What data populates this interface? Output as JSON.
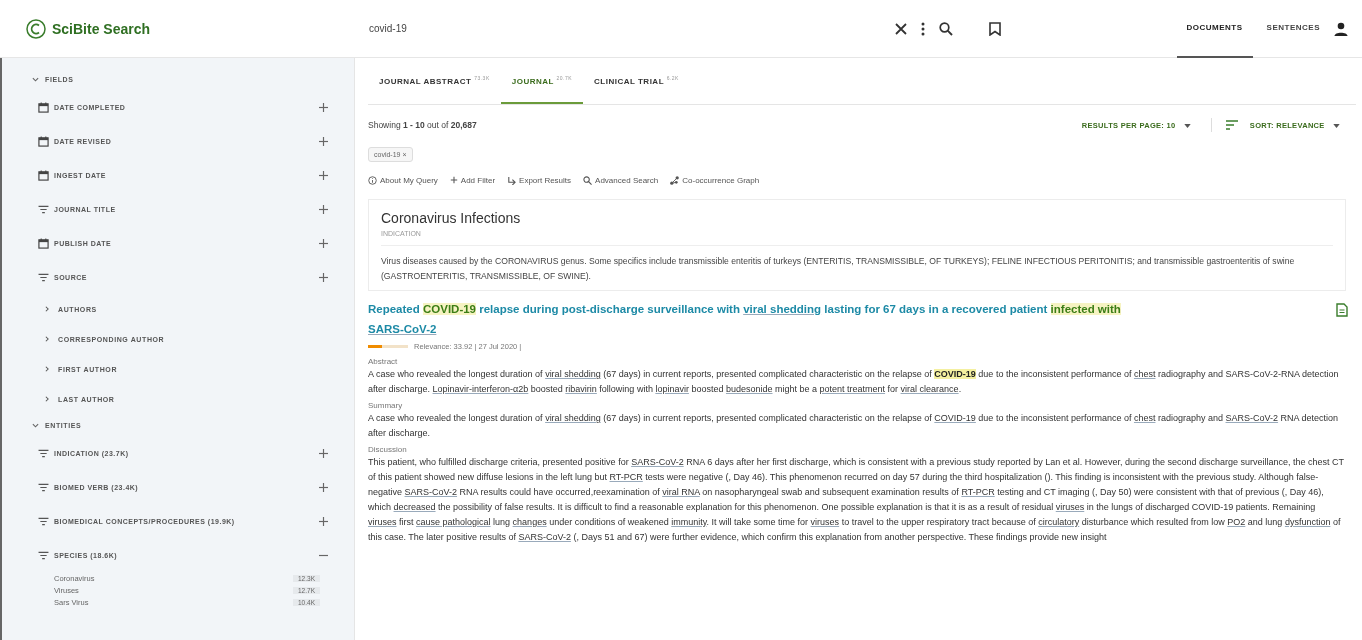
{
  "topbar": {
    "logo": "SciBite Search",
    "search_value": "covid-19",
    "nav": [
      {
        "label": "DOCUMENTS",
        "selected": true
      },
      {
        "label": "SENTENCES",
        "selected": false
      }
    ]
  },
  "sidebar": {
    "sections": [
      {
        "title": "FIELDS",
        "expanded": true,
        "items": [
          {
            "kind": "date",
            "label": "DATE COMPLETED",
            "expanded": false
          },
          {
            "kind": "date",
            "label": "DATE REVISED",
            "expanded": false
          },
          {
            "kind": "date",
            "label": "INGEST DATE",
            "expanded": false
          },
          {
            "kind": "filter",
            "label": "JOURNAL TITLE",
            "expanded": false
          },
          {
            "kind": "date",
            "label": "PUBLISH DATE",
            "expanded": false
          },
          {
            "kind": "filter",
            "label": "SOURCE",
            "expanded": false
          },
          {
            "kind": "sub",
            "label": "AUTHORS"
          },
          {
            "kind": "sub",
            "label": "CORRESPONDING AUTHOR"
          },
          {
            "kind": "sub",
            "label": "FIRST AUTHOR"
          },
          {
            "kind": "sub",
            "label": "LAST AUTHOR"
          }
        ]
      },
      {
        "title": "ENTITIES",
        "expanded": true,
        "items": [
          {
            "kind": "filter",
            "label": "INDICATION (23.7K)",
            "expanded": false
          },
          {
            "kind": "filter",
            "label": "BIOMED VERB (23.4K)",
            "expanded": false
          },
          {
            "kind": "filter",
            "label": "BIOMEDICAL CONCEPTS/PROCEDURES (19.9K)",
            "expanded": false
          },
          {
            "kind": "filter",
            "label": "SPECIES (18.6K)",
            "expanded": true,
            "values": [
              {
                "name": "Coronavirus",
                "count": "12.3K"
              },
              {
                "name": "Viruses",
                "count": "12.7K"
              },
              {
                "name": "Sars Virus",
                "count": "10.4K"
              }
            ]
          }
        ]
      }
    ]
  },
  "main": {
    "tabs": [
      {
        "label": "JOURNAL ABSTRACT",
        "count": "73.3K",
        "selected": false
      },
      {
        "label": "JOURNAL",
        "count": "20.7K",
        "selected": true
      },
      {
        "label": "CLINICAL TRIAL",
        "count": "6.2K",
        "selected": false
      }
    ],
    "showing": "Showing **1 - 10** out of **20,687**",
    "results_per_page": "RESULTS PER PAGE: 10",
    "sort": "SORT: RELEVANCE",
    "chips": [
      "covid-19 ×"
    ],
    "actions": [
      {
        "kind": "info",
        "label": "About My Query"
      },
      {
        "kind": "add",
        "label": "Add Filter"
      },
      {
        "kind": "export",
        "label": "Export Results"
      },
      {
        "kind": "search",
        "label": "Advanced Search"
      },
      {
        "kind": "graph",
        "label": "Co-occurrence Graph"
      }
    ],
    "concept": {
      "title": "Coronavirus Infections",
      "type": "INDICATION",
      "description": "Virus diseases caused by the CORONAVIRUS genus. Some specifics include transmissible enteritis of turkeys (ENTERITIS, TRANSMISSIBLE, OF TURKEYS); FELINE INFECTIOUS PERITONITIS; and transmissible gastroenteritis of swine (GASTROENTERITIS, TRANSMISSIBLE, OF SWINE)."
    },
    "result": {
      "title": [
        {
          "kind": "text",
          "text": "Repeated "
        },
        {
          "kind": "highlight",
          "text": "COVID-19"
        },
        {
          "kind": "text",
          "text": " relapse during post-discharge surveillance with "
        },
        {
          "kind": "term",
          "text": "viral shedding"
        },
        {
          "kind": "text",
          "text": " lasting for 67 days in a recovered patient "
        },
        {
          "kind": "highlight",
          "text": "infected with "
        },
        {
          "kind": "term",
          "text": "SARS-CoV-2"
        }
      ],
      "relevance": {
        "level": 0.35
      },
      "meta": "Relevance: 33.92 | 27 Jul 2020 |",
      "sections": [
        {
          "heading": "Abstract",
          "segments": [
            {
              "kind": "text",
              "text": "A case who revealed the longest duration of "
            },
            {
              "kind": "term",
              "text": "viral shedding"
            },
            {
              "kind": "text",
              "text": " (67 days) in current reports, presented complicated characteristic on the relapse of "
            },
            {
              "kind": "highlight",
              "text": "COVID-19"
            },
            {
              "kind": "text",
              "text": " due to the inconsistent performance of "
            },
            {
              "kind": "term",
              "text": "chest"
            },
            {
              "kind": "text",
              "text": " radiography and SARS-CoV-2-RNA detection after discharge. "
            },
            {
              "kind": "term",
              "text": "Lopinavir-interferon-α2b"
            },
            {
              "kind": "text",
              "text": " boosted "
            },
            {
              "kind": "term",
              "text": "ribavirin"
            },
            {
              "kind": "text",
              "text": " following with "
            },
            {
              "kind": "term",
              "text": "lopinavir"
            },
            {
              "kind": "text",
              "text": " boosted "
            },
            {
              "kind": "term",
              "text": "budesonide"
            },
            {
              "kind": "text",
              "text": " might be a "
            },
            {
              "kind": "term",
              "text": "potent treatment"
            },
            {
              "kind": "text",
              "text": " for "
            },
            {
              "kind": "term",
              "text": "viral clearance"
            },
            {
              "kind": "text",
              "text": "."
            }
          ]
        },
        {
          "heading": "Summary",
          "segments": [
            {
              "kind": "text",
              "text": "A case who revealed the longest duration of "
            },
            {
              "kind": "term",
              "text": "viral shedding"
            },
            {
              "kind": "text",
              "text": " (67 days) in current reports, presented complicated characteristic on the relapse of "
            },
            {
              "kind": "term",
              "text": "COVID-19"
            },
            {
              "kind": "text",
              "text": " due to the inconsistent performance of "
            },
            {
              "kind": "term",
              "text": "chest"
            },
            {
              "kind": "text",
              "text": " radiography and "
            },
            {
              "kind": "term",
              "text": "SARS-CoV-2"
            },
            {
              "kind": "text",
              "text": " RNA detection after discharge."
            }
          ]
        },
        {
          "heading": "Discussion",
          "segments": [
            {
              "kind": "text",
              "text": "This patient, who fulfilled discharge criteria, presented positive for "
            },
            {
              "kind": "term",
              "text": "SARS-CoV-2"
            },
            {
              "kind": "text",
              "text": " RNA 6 days after her first discharge, which is consistent with a previous study reported by Lan et al. However, during the second discharge surveillance, the chest CT of this patient showed new diffuse lesions in the left lung but "
            },
            {
              "kind": "term",
              "text": "RT-PCR"
            },
            {
              "kind": "text",
              "text": " tests were negative (, Day 46). This phenomenon recurred on day 57 during the third hospitalization (). This finding is inconsistent with the previous study. Although false-negative "
            },
            {
              "kind": "term",
              "text": "SARS-CoV-2"
            },
            {
              "kind": "text",
              "text": " RNA results could have occurred,reexamination of "
            },
            {
              "kind": "term",
              "text": "viral RNA"
            },
            {
              "kind": "text",
              "text": " on nasopharyngeal swab and subsequent examination results of "
            },
            {
              "kind": "term",
              "text": "RT-PCR"
            },
            {
              "kind": "text",
              "text": " testing and CT imaging (, Day 50) were consistent with that of previous (, Day 46), which "
            },
            {
              "kind": "term",
              "text": "decreased"
            },
            {
              "kind": "text",
              "text": " the possibility of false results. It is difficult to find a reasonable explanation for this phenomenon. One possible explanation is that it is as a result of residual "
            },
            {
              "kind": "term",
              "text": "viruses"
            },
            {
              "kind": "text",
              "text": " in the lungs of discharged COVID-19 patients. Remaining "
            },
            {
              "kind": "term",
              "text": "viruses"
            },
            {
              "kind": "text",
              "text": " first "
            },
            {
              "kind": "term",
              "text": "cause pathological"
            },
            {
              "kind": "text",
              "text": " lung "
            },
            {
              "kind": "term",
              "text": "changes"
            },
            {
              "kind": "text",
              "text": " under conditions of weakened "
            },
            {
              "kind": "term",
              "text": "immunity"
            },
            {
              "kind": "text",
              "text": ". It will take some time for "
            },
            {
              "kind": "term",
              "text": "viruses"
            },
            {
              "kind": "text",
              "text": " to travel to the upper respiratory tract because of "
            },
            {
              "kind": "term",
              "text": "circulatory"
            },
            {
              "kind": "text",
              "text": " disturbance which resulted from low "
            },
            {
              "kind": "term",
              "text": "PO2"
            },
            {
              "kind": "text",
              "text": " and lung "
            },
            {
              "kind": "term",
              "text": "dysfunction"
            },
            {
              "kind": "text",
              "text": " of this case. The later positive results of "
            },
            {
              "kind": "term",
              "text": "SARS-CoV-2"
            },
            {
              "kind": "text",
              "text": " (, Days 51 and 67) were further evidence, which confirm this explanation from another perspective. These findings provide new insight"
            }
          ]
        }
      ]
    }
  }
}
